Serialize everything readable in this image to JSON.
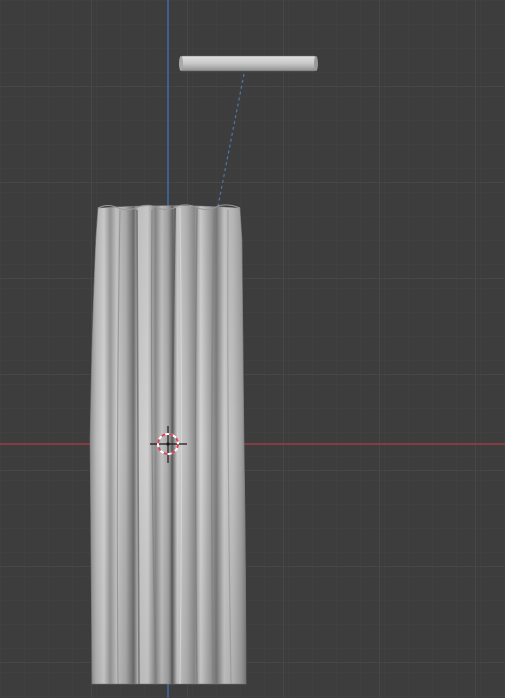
{
  "viewport": {
    "name": "3D Viewport",
    "background_color": "#3d3d3d",
    "grid_minor_color": "#444444",
    "grid_major_color": "#4d4d4d",
    "x_axis_color": "#9c3b44",
    "y_axis_color": "#3f6fb0"
  },
  "scene": {
    "objects": [
      {
        "type": "cylinder",
        "role": "curtain-rod",
        "color": "#c8c8c8"
      },
      {
        "type": "cloth-mesh",
        "role": "curtain",
        "color": "#bdbdbd"
      },
      {
        "type": "relationship-line",
        "style": "dashed",
        "color": "#4d79a8"
      },
      {
        "type": "3d-cursor",
        "color": "#d9465a"
      }
    ]
  },
  "icons": {
    "cursor": "3d-cursor-icon"
  }
}
